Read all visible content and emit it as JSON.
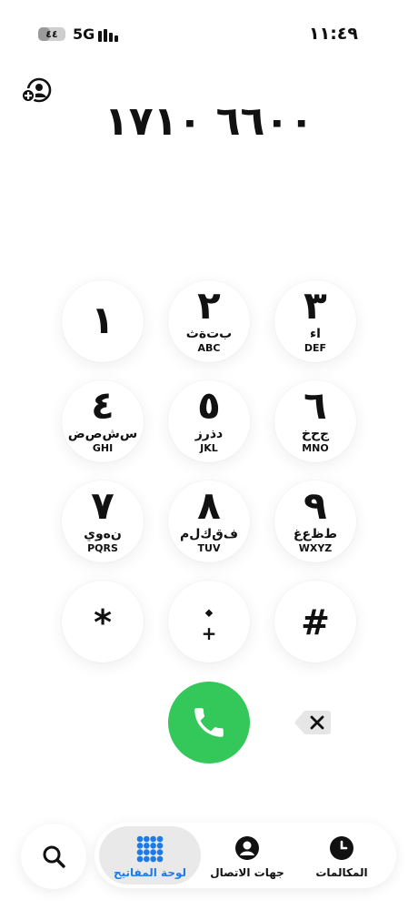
{
  "status_bar": {
    "time": "١١:٤٩",
    "network": "5G",
    "battery_label": "٤٤",
    "battery_level_percent": 44,
    "icons": [
      "battery-icon",
      "signal-bars-icon"
    ]
  },
  "dialer": {
    "number": "٦٦٠٠ ١٧١٠",
    "add_contact_icon": "add-contact-icon"
  },
  "keypad": {
    "keys": [
      {
        "digit": "١",
        "arabic": "",
        "latin": ""
      },
      {
        "digit": "٢",
        "arabic": "ب‌ت‌ة‌ث",
        "latin": "ABC"
      },
      {
        "digit": "٣",
        "arabic": "اء",
        "latin": "DEF"
      },
      {
        "digit": "٤",
        "arabic": "س‌ش‌ص‌ض",
        "latin": "GHI"
      },
      {
        "digit": "٥",
        "arabic": "د‌ذ‌ر‌ز",
        "latin": "JKL"
      },
      {
        "digit": "٦",
        "arabic": "ج‌ح‌خ",
        "latin": "MNO"
      },
      {
        "digit": "٧",
        "arabic": "ن‌ه‌و‌ي",
        "latin": "PQRS"
      },
      {
        "digit": "٨",
        "arabic": "ف‌ق‌ك‌ل‌م",
        "latin": "TUV"
      },
      {
        "digit": "٩",
        "arabic": "ط‌ظ‌ع‌غ",
        "latin": "WXYZ"
      },
      {
        "digit": "*",
        "arabic": "",
        "latin": ""
      },
      {
        "digit": "⬩",
        "arabic": "",
        "latin": "+"
      },
      {
        "digit": "#",
        "arabic": "",
        "latin": ""
      }
    ]
  },
  "actions": {
    "call_icon": "phone-icon",
    "delete_icon": "backspace-icon"
  },
  "bottom_nav": {
    "search_icon": "search-icon",
    "tabs": [
      {
        "label": "لوحة المفاتيح",
        "icon": "keypad-grid-icon",
        "active": true
      },
      {
        "label": "جهات الاتصال",
        "icon": "contact-person-icon",
        "active": false
      },
      {
        "label": "المكالمات",
        "icon": "clock-icon",
        "active": false
      }
    ]
  },
  "colors": {
    "accent": "#1e7be6",
    "call_green": "#34c759",
    "tab_active_bg": "#e9e9e9"
  }
}
